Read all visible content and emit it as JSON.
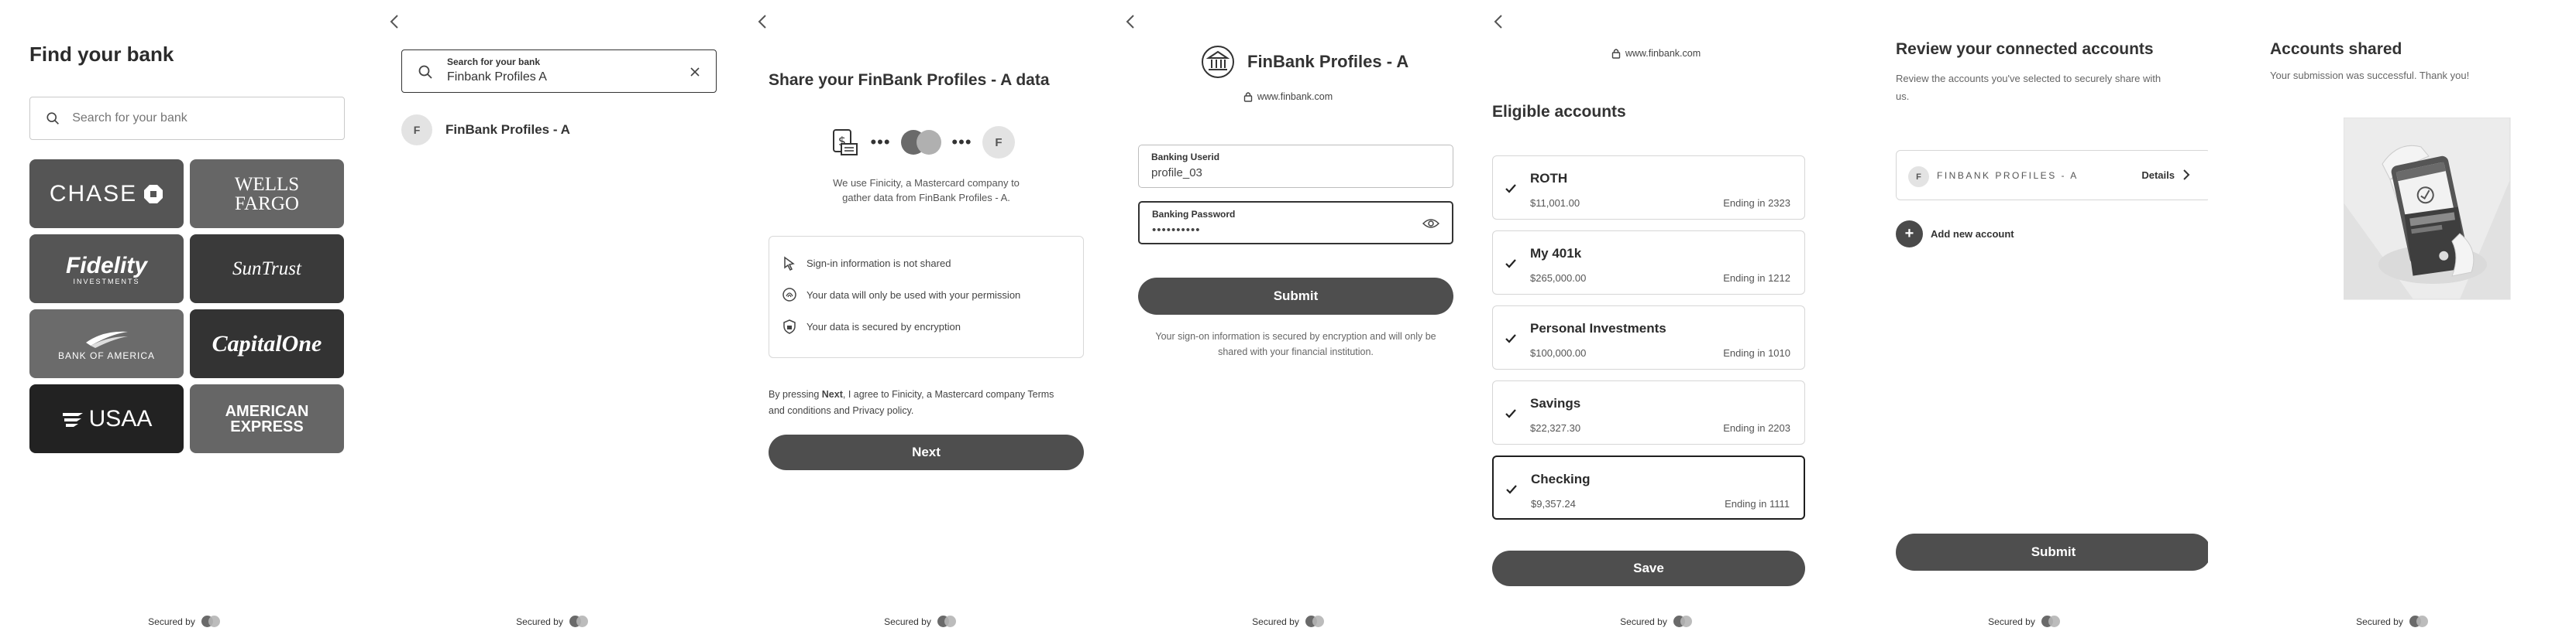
{
  "common": {
    "secured_by": "Secured by"
  },
  "screen1": {
    "title": "Find your bank",
    "search_placeholder": "Search for your bank",
    "banks": [
      "CHASE",
      "WELLS FARGO",
      "Fidelity",
      "SunTrust",
      "BANK OF AMERICA",
      "CapitalOne",
      "USAA",
      "AMERICAN EXPRESS"
    ],
    "fidelity_sub": "INVESTMENTS"
  },
  "screen2": {
    "search_label": "Search for your bank",
    "search_value": "Finbank Profiles A",
    "result": {
      "avatar": "F",
      "name": "FinBank Profiles - A"
    }
  },
  "screen3": {
    "title": "Share your FinBank Profiles - A data",
    "avatar": "F",
    "intro_line1": "We use Finicity, a Mastercard company to",
    "intro_line2": "gather data from FinBank Profiles - A.",
    "features": [
      "Sign-in information is not shared",
      "Your data will only be used with your permission",
      "Your data is secured by encryption"
    ],
    "terms_prefix": "By pressing ",
    "terms_next": "Next",
    "terms_line1_rest": ", I agree to Finicity, a Mastercard company Terms",
    "terms_line2": "and conditions and Privacy policy.",
    "next_button": "Next"
  },
  "screen4": {
    "bank_name": "FinBank Profiles - A",
    "url": "www.finbank.com",
    "userid_label": "Banking Userid",
    "userid_value": "profile_03",
    "password_label": "Banking Password",
    "password_value": "••••••••••",
    "submit_button": "Submit",
    "notice_line1": "Your sign-on information is secured by encryption and will only be",
    "notice_line2": "shared with your financial institution."
  },
  "screen5": {
    "url": "www.finbank.com",
    "title": "Eligible accounts",
    "accounts": [
      {
        "name": "ROTH",
        "amount": "$11,001.00",
        "ending": "Ending in 2323"
      },
      {
        "name": "My 401k",
        "amount": "$265,000.00",
        "ending": "Ending in 1212"
      },
      {
        "name": "Personal Investments",
        "amount": "$100,000.00",
        "ending": "Ending in 1010"
      },
      {
        "name": "Savings",
        "amount": "$22,327.30",
        "ending": "Ending in 2203"
      },
      {
        "name": "Checking",
        "amount": "$9,357.24",
        "ending": "Ending in 1111"
      }
    ],
    "save_button": "Save"
  },
  "screen6": {
    "title": "Review your connected accounts",
    "subtitle_line1": "Review the accounts you've selected to securely share with",
    "subtitle_line2": "us.",
    "connected": {
      "avatar": "F",
      "name": "FINBANK PROFILES - A",
      "details": "Details"
    },
    "add_account": "Add new account",
    "submit_button": "Submit"
  },
  "screen7": {
    "title": "Accounts shared",
    "subtitle": "Your submission was successful. Thank you!"
  }
}
